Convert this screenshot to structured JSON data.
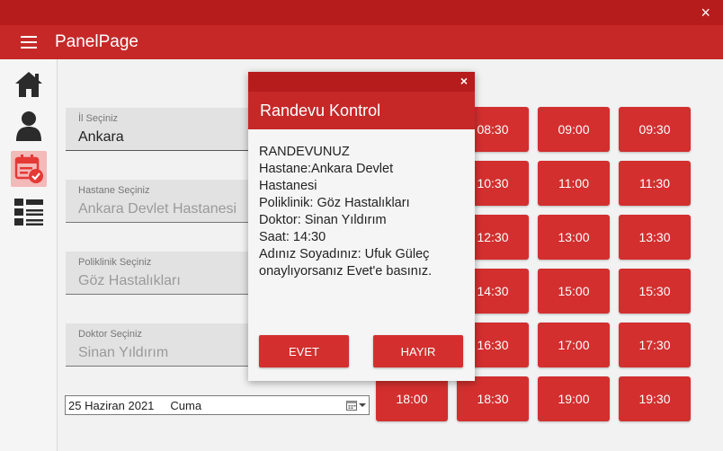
{
  "app": {
    "title": "PanelPage"
  },
  "form": {
    "il": {
      "label": "İl Seçiniz",
      "value": "Ankara"
    },
    "hastane": {
      "label": "Hastane Seçiniz",
      "value": "Ankara Devlet Hastanesi"
    },
    "poliklinik": {
      "label": "Poliklinik Seçiniz",
      "value": "Göz Hastalıkları"
    },
    "doktor": {
      "label": "Doktor Seçiniz",
      "value": "Sinan Yıldırım"
    },
    "date": {
      "value": "25 Haziran 2021",
      "day": "Cuma"
    }
  },
  "slots": [
    "08:30",
    "09:00",
    "09:30",
    "10:30",
    "11:00",
    "11:30",
    "12:30",
    "13:00",
    "13:30",
    "14:30",
    "15:00",
    "15:30",
    "16:30",
    "17:00",
    "17:30",
    "18:00",
    "18:30",
    "19:00",
    "19:30"
  ],
  "dialog": {
    "title": "Randevu Kontrol",
    "close": "×",
    "lines": [
      "RANDEVUNUZ",
      "Hastane:Ankara Devlet",
      "Hastanesi",
      "Poliklinik: Göz Hastalıkları",
      "Doktor: Sinan Yıldırım",
      "Saat: 14:30",
      "Adınız Soyadınız: Ufuk Güleç",
      "onaylıyorsanız Evet'e basınız."
    ],
    "yes": "EVET",
    "no": "HAYIR"
  },
  "window": {
    "close": "×"
  },
  "colors": {
    "primary": "#c62828",
    "dark": "#b71c1c",
    "button": "#d32f2f"
  }
}
